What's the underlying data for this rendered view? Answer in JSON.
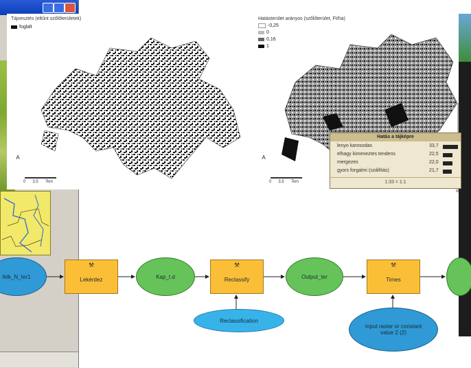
{
  "left_map": {
    "title": "Tájvesztés (eltűnt szőlőterületek)",
    "legend": [
      {
        "label": "foglalt",
        "color": "#111111"
      }
    ],
    "north_label": "A",
    "scale_labels": [
      "0",
      "3,5",
      "7km"
    ]
  },
  "right_map": {
    "title": "Hatásterület arányos (szőlőterület, Ft/ha)",
    "legend": [
      {
        "label": "-0,25",
        "color": "#ffffff"
      },
      {
        "label": "0",
        "color": "#bbbbbb"
      },
      {
        "label": "0,16",
        "color": "#666666"
      },
      {
        "label": "1",
        "color": "#111111"
      }
    ],
    "north_label": "A",
    "scale_labels": [
      "0",
      "3,5",
      "7km"
    ]
  },
  "popup": {
    "title": "Hatás a tájképre",
    "rows": [
      {
        "label": "lenyo karosodas",
        "value": "33,7",
        "fraction": 0.9
      },
      {
        "label": "elhagy kimeneztes tendens",
        "value": "22,5",
        "fraction": 0.6
      },
      {
        "label": "mergezes",
        "value": "22,0",
        "fraction": 0.58
      },
      {
        "label": "gyors forgalmi (szállítás)",
        "value": "21,7",
        "fraction": 0.56
      }
    ],
    "footer": "1:33 = 1:1"
  },
  "diagram": {
    "nodes": [
      {
        "label": "felk_N_ter1"
      },
      {
        "label": "Lekérdez"
      },
      {
        "label": "Kap_t.d"
      },
      {
        "label": "Reclassify"
      },
      {
        "label": "Output_ter"
      },
      {
        "label": "Times"
      },
      {
        "label": "Reclassification"
      },
      {
        "label": "Input raster or constant value 2 (2)"
      }
    ]
  },
  "colors": {
    "input_blue": "#2f9ad6",
    "output_green": "#66c35a",
    "tool_orange": "#fbbf37",
    "param_lightblue": "#37b3ea"
  }
}
